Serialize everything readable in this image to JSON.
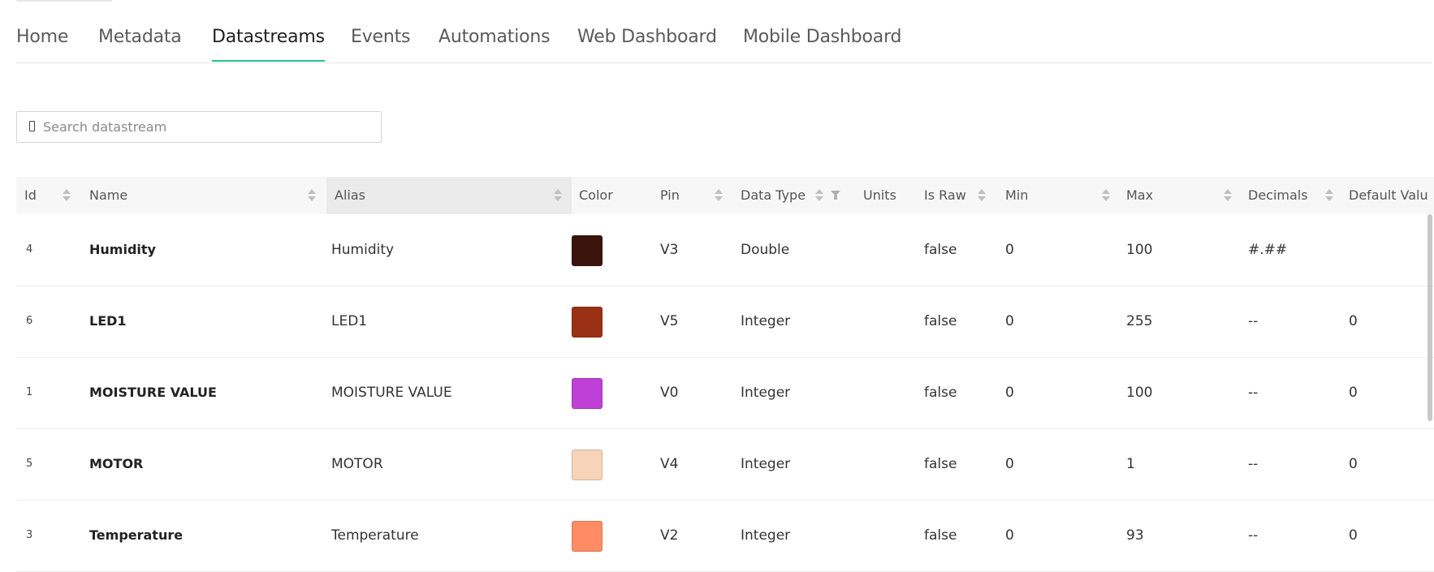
{
  "tabs": [
    {
      "label": "Home",
      "active": false
    },
    {
      "label": "Metadata",
      "active": false
    },
    {
      "label": "Datastreams",
      "active": true
    },
    {
      "label": "Events",
      "active": false
    },
    {
      "label": "Automations",
      "active": false
    },
    {
      "label": "Web Dashboard",
      "active": false
    },
    {
      "label": "Mobile Dashboard",
      "active": false
    }
  ],
  "search": {
    "placeholder": "Search datastream",
    "value": "",
    "icon": "search-icon"
  },
  "table": {
    "columns": {
      "id": "Id",
      "name": "Name",
      "alias": "Alias",
      "color": "Color",
      "pin": "Pin",
      "data_type": "Data Type",
      "units": "Units",
      "is_raw": "Is Raw",
      "min": "Min",
      "max": "Max",
      "decimals": "Decimals",
      "default_value": "Default Valu"
    },
    "sorted_column": "Alias",
    "rows": [
      {
        "id": "4",
        "name": "Humidity",
        "alias": "Humidity",
        "color": "#3a140b",
        "pin": "V3",
        "data_type": "Double",
        "units": "",
        "is_raw": "false",
        "min": "0",
        "max": "100",
        "decimals": "#.##",
        "default_value": ""
      },
      {
        "id": "6",
        "name": "LED1",
        "alias": "LED1",
        "color": "#9a3114",
        "pin": "V5",
        "data_type": "Integer",
        "units": "",
        "is_raw": "false",
        "min": "0",
        "max": "255",
        "decimals": "--",
        "default_value": "0"
      },
      {
        "id": "1",
        "name": "MOISTURE VALUE",
        "alias": "MOISTURE VALUE",
        "color": "#bf40d6",
        "pin": "V0",
        "data_type": "Integer",
        "units": "",
        "is_raw": "false",
        "min": "0",
        "max": "100",
        "decimals": "--",
        "default_value": "0"
      },
      {
        "id": "5",
        "name": "MOTOR",
        "alias": "MOTOR",
        "color": "#f7d4b8",
        "pin": "V4",
        "data_type": "Integer",
        "units": "",
        "is_raw": "false",
        "min": "0",
        "max": "1",
        "decimals": "--",
        "default_value": "0"
      },
      {
        "id": "3",
        "name": "Temperature",
        "alias": "Temperature",
        "color": "#ff8c64",
        "pin": "V2",
        "data_type": "Integer",
        "units": "",
        "is_raw": "false",
        "min": "0",
        "max": "93",
        "decimals": "--",
        "default_value": "0"
      }
    ]
  }
}
